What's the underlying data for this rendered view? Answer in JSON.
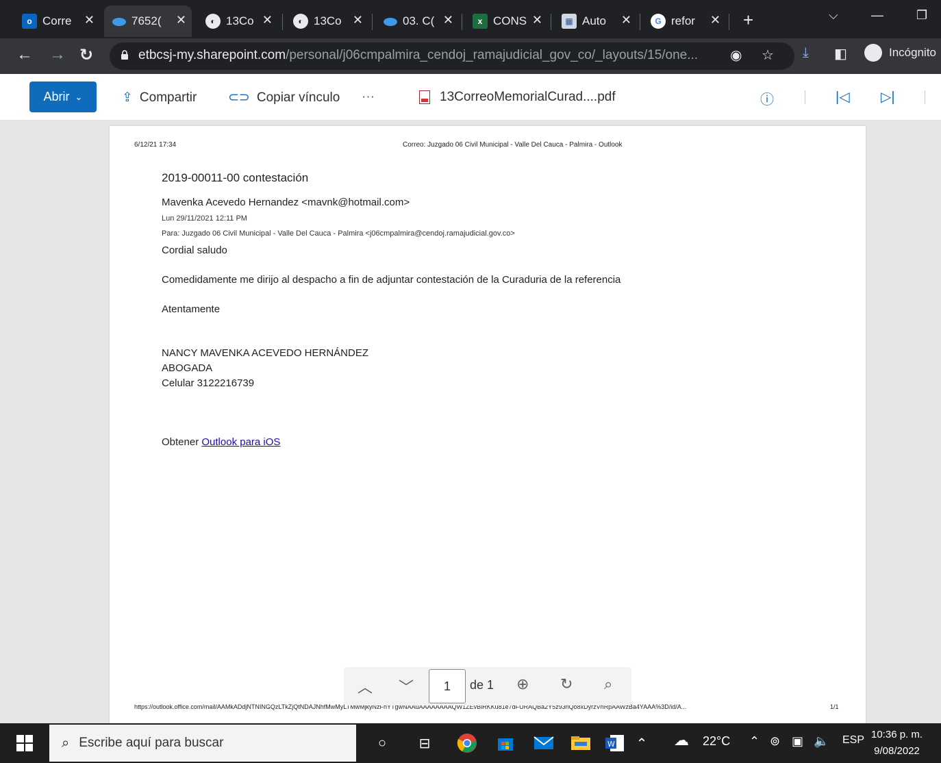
{
  "browser": {
    "tabs": [
      {
        "label": "Corre",
        "icon": "outlook-icon"
      },
      {
        "label": "7652(",
        "icon": "onedrive-icon",
        "active": true
      },
      {
        "label": "13Co",
        "icon": "globe-icon"
      },
      {
        "label": "13Co",
        "icon": "globe-icon"
      },
      {
        "label": "03. C(",
        "icon": "onedrive-icon"
      },
      {
        "label": "CONS",
        "icon": "excel-icon"
      },
      {
        "label": "Auto",
        "icon": "document-image-icon"
      },
      {
        "label": "refor",
        "icon": "google-icon"
      }
    ],
    "url_host": "etbcsj-my.sharepoint.com",
    "url_path": "/personal/j06cmpalmira_cendoj_ramajudicial_gov_co/_layouts/15/one...",
    "profile_label": "Incógnito"
  },
  "toolbar": {
    "open_label": "Abrir",
    "share_label": "Compartir",
    "copy_link_label": "Copiar vínculo",
    "more_label": "···",
    "file_name": "13CorreoMemorialCurad....pdf"
  },
  "document": {
    "header_date": "6/12/21 17:34",
    "header_title": "Correo: Juzgado 06 Civil Municipal - Valle Del Cauca - Palmira - Outlook",
    "subject": "2019-00011-00 contestación",
    "from": "Mavenka Acevedo Hernandez <mavnk@hotmail.com>",
    "date": "Lun 29/11/2021 12:11 PM",
    "to": "Para:  Juzgado 06 Civil Municipal - Valle Del Cauca - Palmira <j06cmpalmira@cendoj.ramajudicial.gov.co>",
    "greeting": "Cordial saludo",
    "body": "Comedidamente me dirijo al despacho a fin de adjuntar contestación de la Curaduria de la referencia",
    "closing": "Atentamente",
    "signature_name": "NANCY MAVENKA ACEVEDO HERNÁNDEZ",
    "signature_title": "ABOGADA",
    "signature_phone": "Celular 3122216739",
    "get_prefix": "Obtener ",
    "get_link": "Outlook para iOS",
    "footer_url": "https://outlook.office.com/mail/AAMkADdjNTNINGQzLTkZjQtNDAJNhfMwMyLTMwMjkyNzFhYTgwNAAuAAAAAAAAQW1ZEvBlRKKu81e7dFURAQBa2Y5z93rlQo8xDyrzVhRpAAWzBa4YAAA%3D/id/A...",
    "footer_page": "1/1"
  },
  "pager": {
    "current_page": "1",
    "of_label": "de 1"
  },
  "taskbar": {
    "search_placeholder": "Escribe aquí para buscar",
    "temperature": "22°C",
    "language": "ESP",
    "time": "10:36 p. m.",
    "date": "9/08/2022"
  }
}
